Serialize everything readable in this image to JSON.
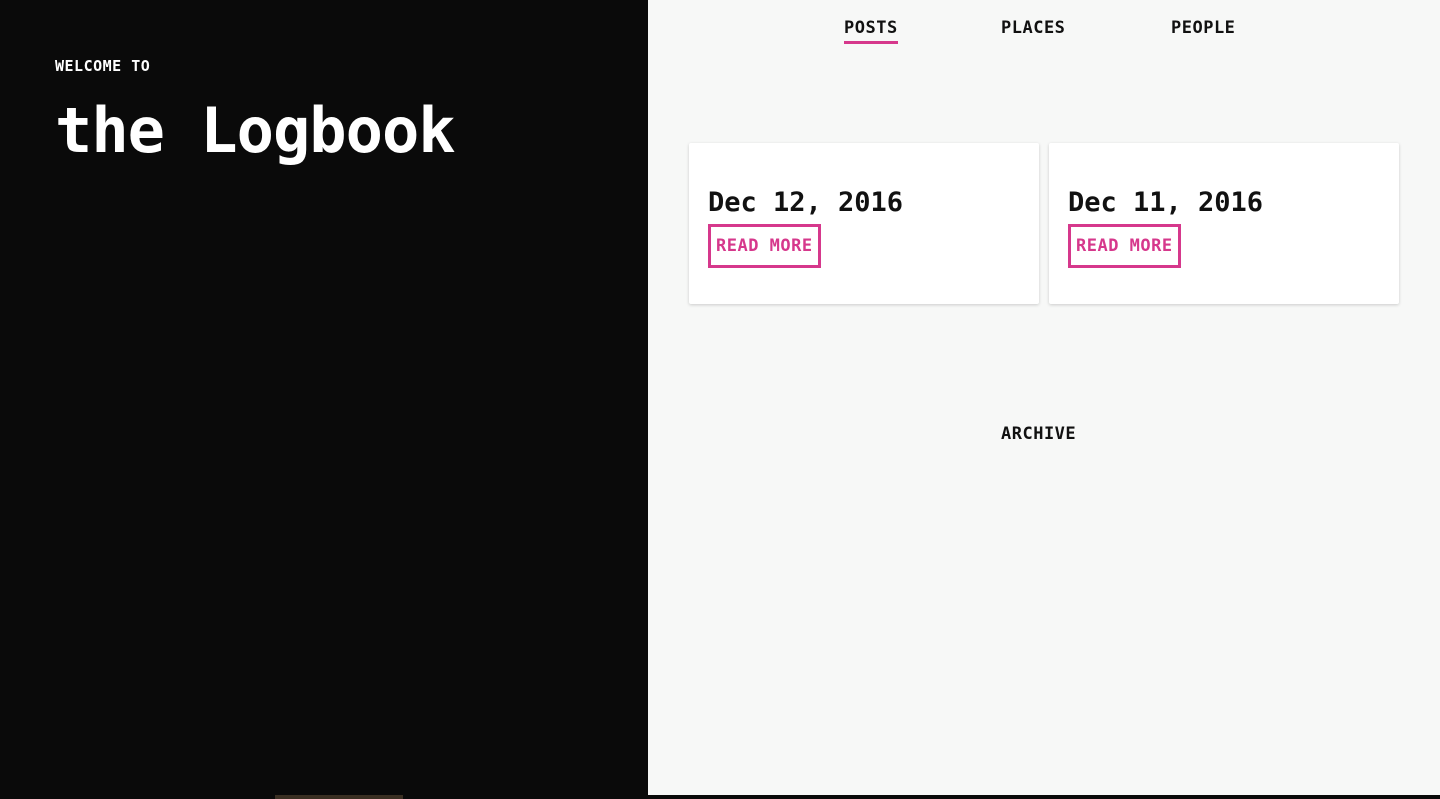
{
  "hero": {
    "kicker": "WELCOME TO",
    "title": "the Logbook"
  },
  "nav": {
    "items": [
      {
        "label": "POSTS",
        "active": true
      },
      {
        "label": "PLACES",
        "active": false
      },
      {
        "label": "PEOPLE",
        "active": false
      }
    ]
  },
  "posts": [
    {
      "date": "Dec 12, 2016",
      "cta": "READ MORE"
    },
    {
      "date": "Dec 11, 2016",
      "cta": "READ MORE"
    }
  ],
  "archive": {
    "label": "ARCHIVE"
  },
  "colors": {
    "accent": "#d6388c",
    "hero_bg": "#0a0a0a",
    "content_bg": "#f7f8f7",
    "card_bg": "#ffffff",
    "text": "#111111"
  }
}
